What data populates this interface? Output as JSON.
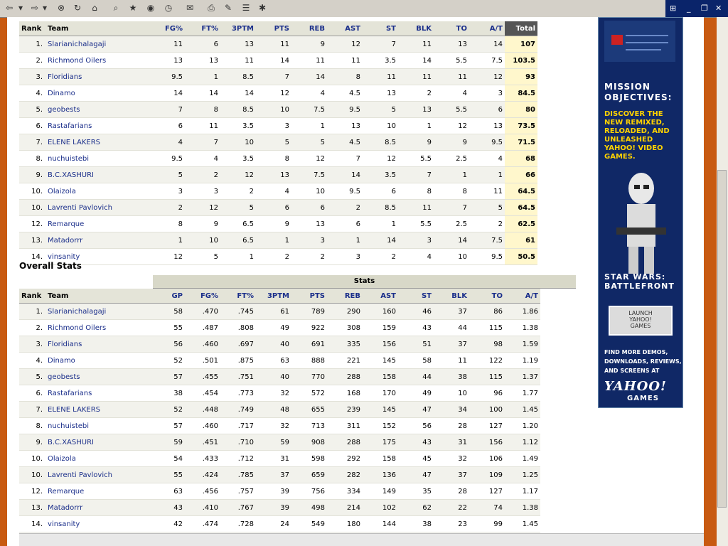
{
  "toolbar": {
    "icons": [
      "back-icon",
      "forward-icon",
      "stop-icon",
      "refresh-icon",
      "home-icon",
      "search-icon",
      "favorites-icon",
      "media-icon",
      "history-icon",
      "mail-icon",
      "print-icon",
      "edit-icon",
      "discuss-icon",
      "messenger-icon"
    ]
  },
  "window": {
    "controls": [
      "_",
      "❐",
      "✕"
    ]
  },
  "colors": {
    "team_link": "#1a2e8a",
    "page_bg": "#c85a11",
    "total_bg": "#fff7cc"
  },
  "ranking": {
    "headers": {
      "rank": "Rank",
      "team": "Team",
      "stats": [
        "FG%",
        "FT%",
        "3PTM",
        "PTS",
        "REB",
        "AST",
        "ST",
        "BLK",
        "TO",
        "A/T"
      ],
      "total": "Total"
    },
    "rows": [
      {
        "rank": "1.",
        "team": "Slarianichalagaji",
        "stats": [
          "11",
          "6",
          "13",
          "11",
          "9",
          "12",
          "7",
          "11",
          "13",
          "14"
        ],
        "total": "107"
      },
      {
        "rank": "2.",
        "team": "Richmond Oilers",
        "stats": [
          "13",
          "13",
          "11",
          "14",
          "11",
          "11",
          "3.5",
          "14",
          "5.5",
          "7.5"
        ],
        "total": "103.5"
      },
      {
        "rank": "3.",
        "team": "Floridians",
        "stats": [
          "9.5",
          "1",
          "8.5",
          "7",
          "14",
          "8",
          "11",
          "11",
          "11",
          "12"
        ],
        "total": "93"
      },
      {
        "rank": "4.",
        "team": "Dinamo",
        "stats": [
          "14",
          "14",
          "14",
          "12",
          "4",
          "4.5",
          "13",
          "2",
          "4",
          "3"
        ],
        "total": "84.5"
      },
      {
        "rank": "5.",
        "team": "geobests",
        "stats": [
          "7",
          "8",
          "8.5",
          "10",
          "7.5",
          "9.5",
          "5",
          "13",
          "5.5",
          "6"
        ],
        "total": "80"
      },
      {
        "rank": "6.",
        "team": "Rastafarians",
        "stats": [
          "6",
          "11",
          "3.5",
          "3",
          "1",
          "13",
          "10",
          "1",
          "12",
          "13"
        ],
        "total": "73.5"
      },
      {
        "rank": "7.",
        "team": "ELENE LAKERS",
        "stats": [
          "4",
          "7",
          "10",
          "5",
          "5",
          "4.5",
          "8.5",
          "9",
          "9",
          "9.5"
        ],
        "total": "71.5"
      },
      {
        "rank": "8.",
        "team": "nuchuistebi",
        "stats": [
          "9.5",
          "4",
          "3.5",
          "8",
          "12",
          "7",
          "12",
          "5.5",
          "2.5",
          "4"
        ],
        "total": "68"
      },
      {
        "rank": "9.",
        "team": "B.C.XASHURI",
        "stats": [
          "5",
          "2",
          "12",
          "13",
          "7.5",
          "14",
          "3.5",
          "7",
          "1",
          "1"
        ],
        "total": "66"
      },
      {
        "rank": "10.",
        "team": "Olaizola",
        "stats": [
          "3",
          "3",
          "2",
          "4",
          "10",
          "9.5",
          "6",
          "8",
          "8",
          "11"
        ],
        "total": "64.5"
      },
      {
        "rank": "10.",
        "team": "Lavrenti Pavlovich",
        "stats": [
          "2",
          "12",
          "5",
          "6",
          "6",
          "2",
          "8.5",
          "11",
          "7",
          "5"
        ],
        "total": "64.5"
      },
      {
        "rank": "12.",
        "team": "Remarque",
        "stats": [
          "8",
          "9",
          "6.5",
          "9",
          "13",
          "6",
          "1",
          "5.5",
          "2.5",
          "2"
        ],
        "total": "62.5"
      },
      {
        "rank": "13.",
        "team": "Matadorrr",
        "stats": [
          "1",
          "10",
          "6.5",
          "1",
          "3",
          "1",
          "14",
          "3",
          "14",
          "7.5"
        ],
        "total": "61"
      },
      {
        "rank": "14.",
        "team": "vinsanity",
        "stats": [
          "12",
          "5",
          "1",
          "2",
          "2",
          "3",
          "2",
          "4",
          "10",
          "9.5"
        ],
        "total": "50.5"
      }
    ]
  },
  "overall": {
    "title": "Overall Stats",
    "group_label": "Stats",
    "headers": {
      "rank": "Rank",
      "team": "Team",
      "stats": [
        "GP",
        "FG%",
        "FT%",
        "3PTM",
        "PTS",
        "REB",
        "AST",
        "ST",
        "BLK",
        "TO",
        "A/T"
      ]
    },
    "rows": [
      {
        "rank": "1.",
        "team": "Slarianichalagaji",
        "stats": [
          "58",
          ".470",
          ".745",
          "61",
          "789",
          "290",
          "160",
          "46",
          "37",
          "86",
          "1.86"
        ]
      },
      {
        "rank": "2.",
        "team": "Richmond Oilers",
        "stats": [
          "55",
          ".487",
          ".808",
          "49",
          "922",
          "308",
          "159",
          "43",
          "44",
          "115",
          "1.38"
        ]
      },
      {
        "rank": "3.",
        "team": "Floridians",
        "stats": [
          "56",
          ".460",
          ".697",
          "40",
          "691",
          "335",
          "156",
          "51",
          "37",
          "98",
          "1.59"
        ]
      },
      {
        "rank": "4.",
        "team": "Dinamo",
        "stats": [
          "52",
          ".501",
          ".875",
          "63",
          "888",
          "221",
          "145",
          "58",
          "11",
          "122",
          "1.19"
        ]
      },
      {
        "rank": "5.",
        "team": "geobests",
        "stats": [
          "57",
          ".455",
          ".751",
          "40",
          "770",
          "288",
          "158",
          "44",
          "38",
          "115",
          "1.37"
        ]
      },
      {
        "rank": "6.",
        "team": "Rastafarians",
        "stats": [
          "38",
          ".454",
          ".773",
          "32",
          "572",
          "168",
          "170",
          "49",
          "10",
          "96",
          "1.77"
        ]
      },
      {
        "rank": "7.",
        "team": "ELENE LAKERS",
        "stats": [
          "52",
          ".448",
          ".749",
          "48",
          "655",
          "239",
          "145",
          "47",
          "34",
          "100",
          "1.45"
        ]
      },
      {
        "rank": "8.",
        "team": "nuchuistebi",
        "stats": [
          "57",
          ".460",
          ".717",
          "32",
          "713",
          "311",
          "152",
          "56",
          "28",
          "127",
          "1.20"
        ]
      },
      {
        "rank": "9.",
        "team": "B.C.XASHURI",
        "stats": [
          "59",
          ".451",
          ".710",
          "59",
          "908",
          "288",
          "175",
          "43",
          "31",
          "156",
          "1.12"
        ]
      },
      {
        "rank": "10.",
        "team": "Olaizola",
        "stats": [
          "54",
          ".433",
          ".712",
          "31",
          "598",
          "292",
          "158",
          "45",
          "32",
          "106",
          "1.49"
        ]
      },
      {
        "rank": "10.",
        "team": "Lavrenti Pavlovich",
        "stats": [
          "55",
          ".424",
          ".785",
          "37",
          "659",
          "282",
          "136",
          "47",
          "37",
          "109",
          "1.25"
        ]
      },
      {
        "rank": "12.",
        "team": "Remarque",
        "stats": [
          "63",
          ".456",
          ".757",
          "39",
          "756",
          "334",
          "149",
          "35",
          "28",
          "127",
          "1.17"
        ]
      },
      {
        "rank": "13.",
        "team": "Matadorrr",
        "stats": [
          "43",
          ".410",
          ".767",
          "39",
          "498",
          "214",
          "102",
          "62",
          "22",
          "74",
          "1.38"
        ]
      },
      {
        "rank": "14.",
        "team": "vinsanity",
        "stats": [
          "42",
          ".474",
          ".728",
          "24",
          "549",
          "180",
          "144",
          "38",
          "23",
          "99",
          "1.45"
        ]
      }
    ]
  },
  "ad": {
    "title_line1": "MISSION",
    "title_line2": "OBJECTIVES:",
    "sub_lines": [
      "DISCOVER THE",
      "NEW REMIXED,",
      "RELOADED, AND",
      "UNLEASHED",
      "YAHOO! VIDEO",
      "GAMES."
    ],
    "game_line1": "STAR WARS:",
    "game_line2": "BATTLEFRONT",
    "button_lines": [
      "LAUNCH",
      "YAHOO!",
      "GAMES"
    ],
    "more_lines": [
      "FIND MORE DEMOS,",
      "DOWNLOADS, REVIEWS,",
      "AND SCREENS AT"
    ],
    "brand": "YAHOO!",
    "brand_sub": "GAMES"
  }
}
